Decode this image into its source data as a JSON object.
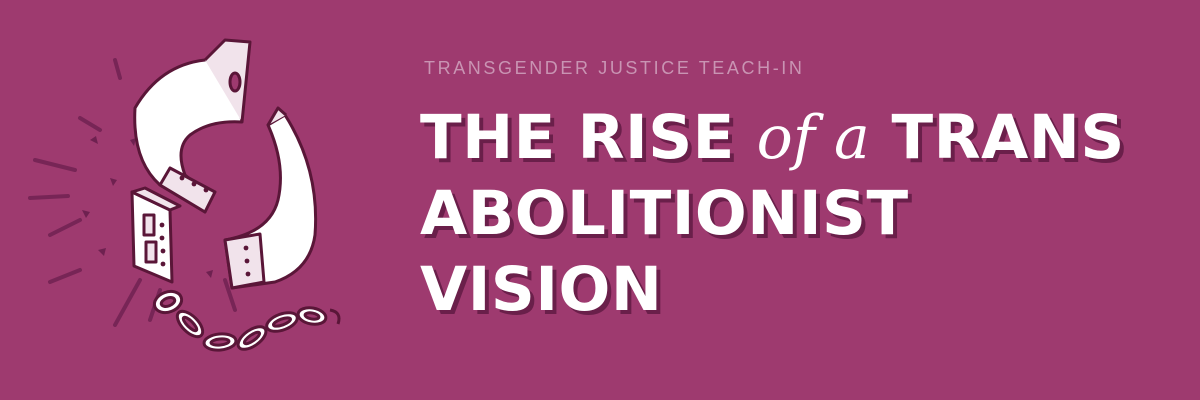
{
  "colors": {
    "background": "#9e3a6f",
    "eyebrow_text": "#c994b3",
    "headline_text": "#ffffff",
    "headline_shadow": "#6a1f4a",
    "illustration_stroke": "#5a1638"
  },
  "illustration": {
    "icon": "broken-shackle-icon"
  },
  "eyebrow": "TRANSGENDER JUSTICE TEACH-IN",
  "headline": {
    "part1": "THE RISE ",
    "connector": "of a",
    "part2": " TRANS",
    "line2": "ABOLITIONIST",
    "line3": "VISION"
  }
}
